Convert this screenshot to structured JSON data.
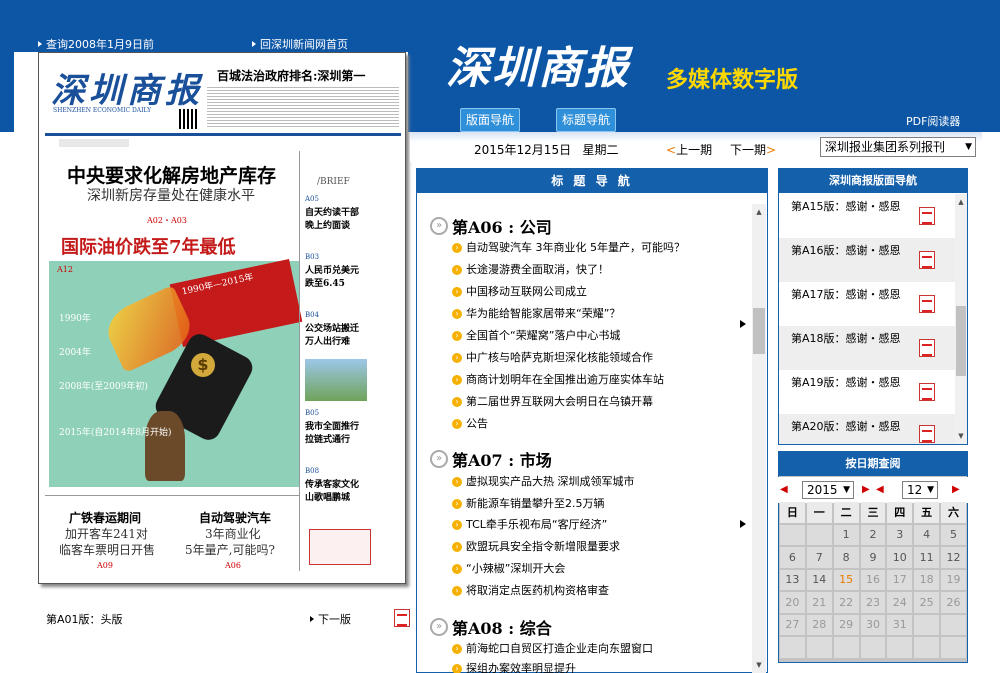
{
  "top_links": {
    "query_date": "查询2008年1月9日前",
    "home_link": "回深圳新闻网首页"
  },
  "brand": {
    "title": "深圳商报",
    "subtitle": "多媒体数字版"
  },
  "nav_buttons": {
    "page_nav": "版面导航",
    "title_nav": "标题导航"
  },
  "pdf_reader": "PDF阅读器",
  "issue": {
    "date": "2015年12月15日",
    "weekday": "星期二",
    "prev": "上一期",
    "next": "下一期",
    "series_select": "深圳报业集团系列报刊"
  },
  "newspaper": {
    "masthead": "深圳商报",
    "masthead_en": "SHENZHEN ECONOMIC DAILY",
    "top_headline": "百城法治政府排名:深圳第一",
    "headline1": "中央要求化解房地产库存",
    "sub1": "深圳新房存量处在健康水平",
    "refs1": "A02・A03",
    "headline2": "国际油价跌至7年最低",
    "tag": "A12",
    "banner": "1990年—2015年",
    "brief_header": "/BRIEF",
    "briefs": [
      {
        "code": "A05",
        "title": "自天约读干部晚上约面谈"
      },
      {
        "code": "B03",
        "title": "人民币兑美元跌至6.45"
      },
      {
        "code": "B04",
        "title": "公交场站搬迁万人出行难"
      },
      {
        "code": "B05",
        "title": "我市全面推行拉链式通行"
      },
      {
        "code": "B08",
        "title": "传承客家文化山歌唱鹏城"
      }
    ],
    "years": [
      "1990年",
      "2004年",
      "2008年(至2009年初)",
      "2015年(自2014年8月开始)"
    ],
    "bottom_left_title": "广铁春运期间",
    "bottom_left_sub1": "加开客车241对",
    "bottom_left_sub2": "临客车票明日开售",
    "bottom_left_ref": "A09",
    "bottom_right_title": "自动驾驶汽车",
    "bottom_right_sub1": "3年商业化",
    "bottom_right_sub2": "5年量产,可能吗?",
    "bottom_right_ref": "A06"
  },
  "page_label": "第A01版：头版",
  "next_page": "下一版",
  "title_nav_header": "标 题 导 航",
  "sections": [
    {
      "title": "第A06 : 公司",
      "articles": [
        "自动驾驶汽车 3年商业化 5年量产，可能吗？",
        "长途漫游费全面取消，快了！",
        "中国移动互联网公司成立",
        "华为能给智能家居带来“荣耀”？",
        "全国首个“荣耀窝”落户中心书城",
        "中广核与哈萨克斯坦深化核能领域合作",
        "商商计划明年在全国推出逾万座实体车站",
        "第二届世界互联网大会明日在乌镇开幕",
        "公告"
      ]
    },
    {
      "title": "第A07 : 市场",
      "articles": [
        "虚拟现实产品大热 深圳成领军城市",
        "新能源车销量攀升至2.5万辆",
        "TCL牵手乐视布局“客厅经济”",
        "欧盟玩具安全指令新增限量要求",
        "“小辣椒”深圳开大会",
        "将取消定点医药机构资格审查"
      ]
    },
    {
      "title": "第A08 : 综合",
      "articles": [
        "前海蛇口自贸区打造企业走向东盟窗口",
        "探组办案效率明显提升"
      ]
    }
  ],
  "page_nav": {
    "header": "深圳商报版面导航",
    "items": [
      "第A15版：感谢・感恩",
      "第A16版：感谢・感恩",
      "第A17版：感谢・感恩",
      "第A18版：感谢・感恩",
      "第A19版：感谢・感恩",
      "第A20版：感谢・感恩"
    ]
  },
  "calendar": {
    "header": "按日期查阅",
    "year": "2015",
    "month": "12",
    "weekdays": [
      "日",
      "一",
      "二",
      "三",
      "四",
      "五",
      "六"
    ],
    "weeks": [
      [
        "",
        "",
        "1",
        "2",
        "3",
        "4",
        "5"
      ],
      [
        "6",
        "7",
        "8",
        "9",
        "10",
        "11",
        "12"
      ],
      [
        "13",
        "14",
        "15",
        "16",
        "17",
        "18",
        "19"
      ],
      [
        "20",
        "21",
        "22",
        "23",
        "24",
        "25",
        "26"
      ],
      [
        "27",
        "28",
        "29",
        "30",
        "31",
        "",
        ""
      ],
      [
        "",
        "",
        "",
        "",
        "",
        "",
        ""
      ]
    ],
    "today": "15",
    "colors": {
      "header": "#1560ab",
      "today": "#e87b00",
      "arrows": "#d10000"
    }
  }
}
